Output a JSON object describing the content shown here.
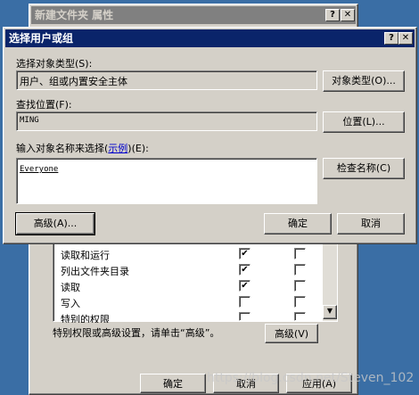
{
  "bg_window": {
    "title": "新建文件夹 属性",
    "help_btn": "?",
    "close_btn": "✕",
    "permissions": [
      {
        "name": "读取和运行",
        "allow": true,
        "deny": false
      },
      {
        "name": "列出文件夹目录",
        "allow": true,
        "deny": false
      },
      {
        "name": "读取",
        "allow": true,
        "deny": false
      },
      {
        "name": "写入",
        "allow": false,
        "deny": false
      },
      {
        "name": "特别的权限",
        "allow": false,
        "deny": false
      }
    ],
    "special_text": "特别权限或高级设置，请单击“高级”。",
    "advanced_btn": "高级(V)",
    "ok_btn": "确定",
    "cancel_btn": "取消",
    "apply_btn": "应用(A)"
  },
  "dialog": {
    "title": "选择用户或组",
    "help_btn": "?",
    "close_btn": "✕",
    "object_type_label": "选择对象类型(S):",
    "object_type_value": "用户、组或内置安全主体",
    "object_type_btn": "对象类型(O)...",
    "location_label": "查找位置(F):",
    "location_value": "MING",
    "location_btn": "位置(L)...",
    "names_label_prefix": "输入对象名称来选择(",
    "names_label_link": "示例",
    "names_label_suffix": ")(E):",
    "names_value": "Everyone",
    "check_names_btn": "检查名称(C)",
    "advanced_btn": "高级(A)...",
    "ok_btn": "确定",
    "cancel_btn": "取消"
  },
  "watermark": "https://blog.csdn.net/Steven_102"
}
